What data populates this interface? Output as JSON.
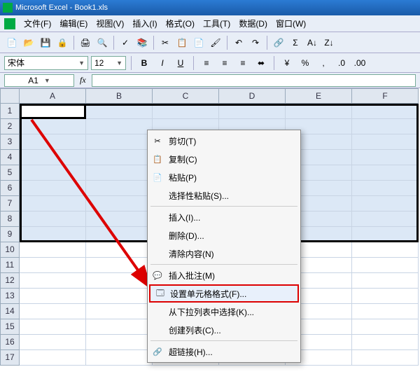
{
  "titlebar": {
    "text": "Microsoft Excel - Book1.xls"
  },
  "menu": {
    "file": "文件(F)",
    "edit": "编辑(E)",
    "view": "视图(V)",
    "insert": "插入(I)",
    "format": "格式(O)",
    "tools": "工具(T)",
    "data": "数据(D)",
    "window": "窗口(W)"
  },
  "formatbar": {
    "font": "宋体",
    "size": "12"
  },
  "namebox": {
    "cell": "A1",
    "fx": "fx"
  },
  "columns": [
    "A",
    "B",
    "C",
    "D",
    "E",
    "F"
  ],
  "rows": [
    "1",
    "2",
    "3",
    "4",
    "5",
    "6",
    "7",
    "8",
    "9",
    "10",
    "11",
    "12",
    "13",
    "14",
    "15",
    "16",
    "17"
  ],
  "context": {
    "cut": "剪切(T)",
    "copy": "复制(C)",
    "paste": "粘贴(P)",
    "paste_special": "选择性粘贴(S)...",
    "insert": "插入(I)...",
    "delete": "删除(D)...",
    "clear": "清除内容(N)",
    "insert_comment": "插入批注(M)",
    "format_cells": "设置单元格格式(F)...",
    "pick_list": "从下拉列表中选择(K)...",
    "create_list": "创建列表(C)...",
    "hyperlink": "超链接(H)..."
  }
}
